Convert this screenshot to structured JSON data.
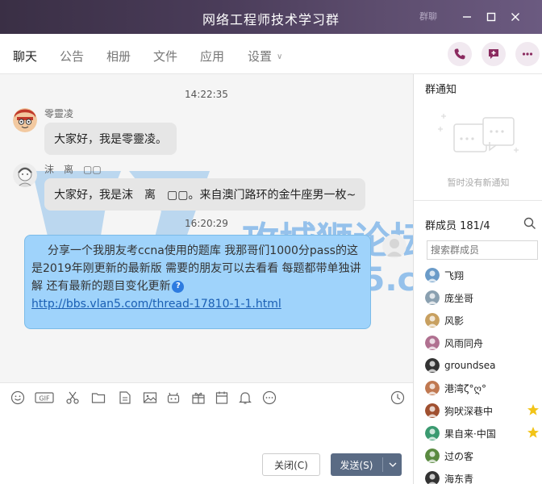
{
  "window": {
    "title": "网络工程师技术学习群",
    "title_deco": "群聊"
  },
  "tabs": [
    {
      "label": "聊天",
      "active": true
    },
    {
      "label": "公告"
    },
    {
      "label": "相册"
    },
    {
      "label": "文件"
    },
    {
      "label": "应用"
    },
    {
      "label": "设置"
    }
  ],
  "messages": [
    {
      "time": "14:22:35",
      "sender": "零靈凌",
      "text": "大家好，我是零靈凌。"
    },
    {
      "sender": "沫　离　▢▢",
      "text": "大家好，我是沫　离　▢▢。来自澳门路环的金牛座男一枚~"
    },
    {
      "time": "16:20:29",
      "text": "分享一个我朋友考ccna使用的题库 我那哥们1000分pass的这是2019年刚更新的最新版 需要的朋友可以去看看 每题都带单独讲解 还有最新的题目变化更新",
      "link": "http://bbs.vlan5.com/thread-17810-1-1.html"
    }
  ],
  "watermark": {
    "line1": "攻城狮论坛",
    "line2": "bbs.vlan5.com"
  },
  "buttons": {
    "close": "关闭(C)",
    "send": "发送(S)"
  },
  "notice": {
    "title": "群通知",
    "empty": "暂时没有新通知"
  },
  "members": {
    "title": "群成员 181/4",
    "search_placeholder": "搜索群成员",
    "list": [
      {
        "name": "飞翔",
        "color": "#6a9bc8"
      },
      {
        "name": "庞坐哥",
        "color": "#8aa0b0"
      },
      {
        "name": "风影",
        "color": "#c8a060"
      },
      {
        "name": "风雨同舟",
        "color": "#b07090"
      },
      {
        "name": "groundsea",
        "color": "#333333"
      },
      {
        "name": "港湾ζ°ღ°",
        "color": "#c07850"
      },
      {
        "name": "狗吠深巷中",
        "color": "#a05030",
        "star": true
      },
      {
        "name": "果自来·中国",
        "color": "#3a9a70",
        "star": true
      },
      {
        "name": "过の客",
        "color": "#5a8a40"
      },
      {
        "name": "海东青",
        "color": "#333333"
      }
    ]
  },
  "colors": {
    "titlebar": "#4a3c59",
    "accent": "#9fd3fb",
    "send_button": "#5a6b84",
    "star": "#f2c418"
  }
}
